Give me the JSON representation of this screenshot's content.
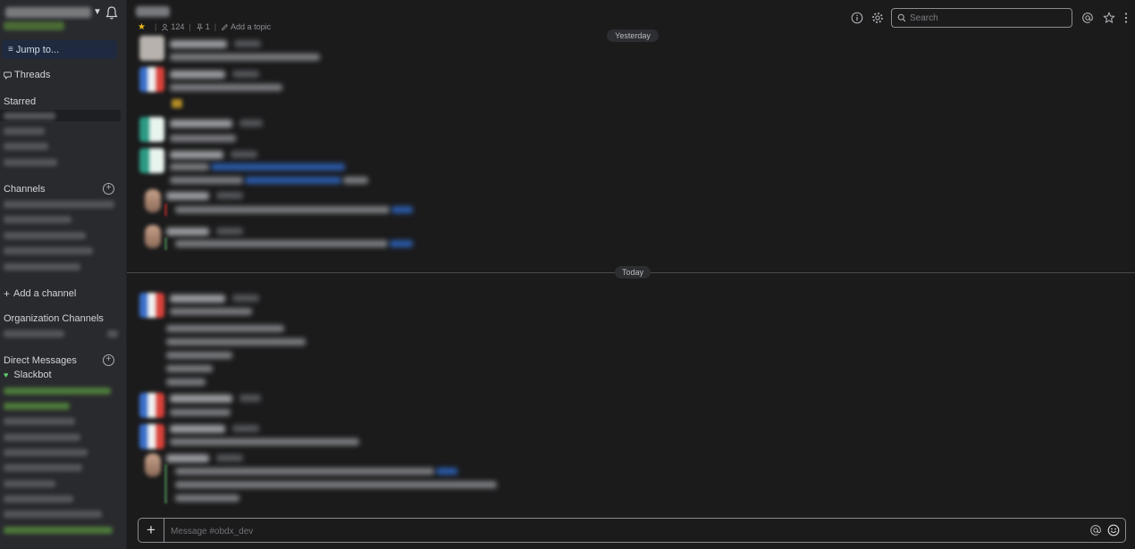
{
  "sidebar": {
    "jump_to": "Jump to...",
    "threads": "Threads",
    "starred": "Starred",
    "channels": "Channels",
    "add_channel": "Add a channel",
    "org_channels": "Organization Channels",
    "direct_messages": "Direct Messages",
    "slackbot": "Slackbot"
  },
  "header": {
    "members": "124",
    "pins": "1",
    "add_topic": "Add a topic"
  },
  "search": {
    "placeholder": "Search"
  },
  "dividers": {
    "yesterday": "Yesterday",
    "today": "Today"
  },
  "composer": {
    "placeholder": "Message #obdx_dev"
  },
  "colors": {
    "accent_star": "#e8b91b",
    "presence": "#5fcf6e",
    "jump_bg": "#1f2a40"
  }
}
